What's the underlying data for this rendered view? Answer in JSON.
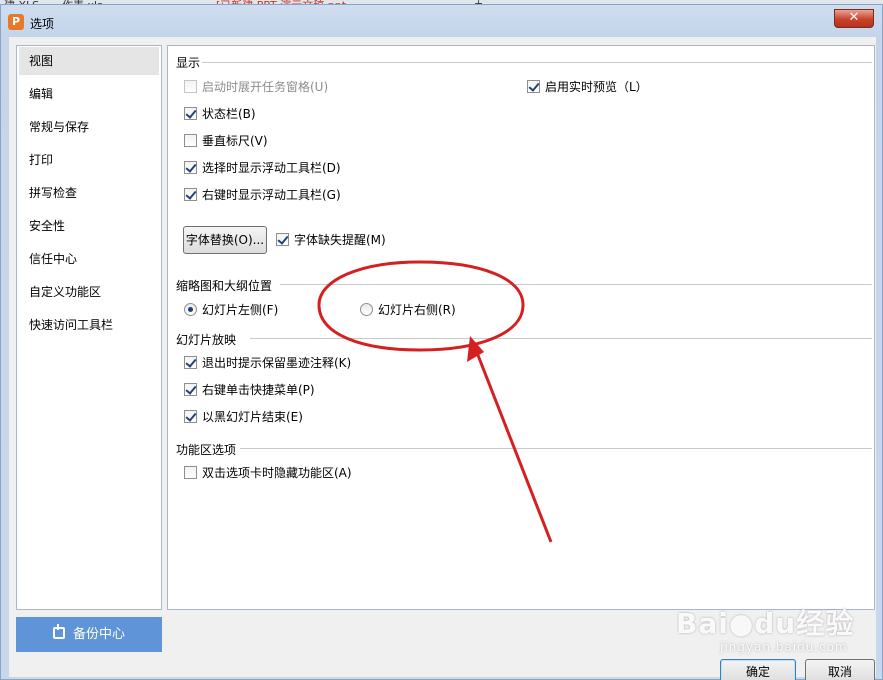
{
  "background_tabs": [
    "建.XLS",
    "作表.xls",
    "[已新建 PPT 演示文稿.ppt",
    "+"
  ],
  "window": {
    "title": "选项",
    "close_label": "✕"
  },
  "nav": {
    "items": [
      {
        "label": "视图",
        "active": true
      },
      {
        "label": "编辑",
        "active": false
      },
      {
        "label": "常规与保存",
        "active": false
      },
      {
        "label": "打印",
        "active": false
      },
      {
        "label": "拼写检查",
        "active": false
      },
      {
        "label": "安全性",
        "active": false
      },
      {
        "label": "信任中心",
        "active": false
      },
      {
        "label": "自定义功能区",
        "active": false
      },
      {
        "label": "快速访问工具栏",
        "active": false
      }
    ],
    "backup_label": "备份中心"
  },
  "display": {
    "heading": "显示",
    "options": {
      "startup_task_pane": {
        "label": "启动时展开任务窗格(U)",
        "checked": false,
        "disabled": true
      },
      "live_preview": {
        "label": "启用实时预览（L）",
        "checked": true
      },
      "status_bar": {
        "label": "状态栏(B)",
        "checked": true
      },
      "vertical_ruler": {
        "label": "垂直标尺(V)",
        "checked": false
      },
      "float_toolbar_select": {
        "label": "选择时显示浮动工具栏(D)",
        "checked": true
      },
      "float_toolbar_rightclick": {
        "label": "右键时显示浮动工具栏(G)",
        "checked": true
      },
      "font_missing_alert": {
        "label": "字体缺失提醒(M)",
        "checked": true
      }
    },
    "font_replace_button": "字体替换(O)..."
  },
  "thumbnail": {
    "heading": "缩略图和大纲位置",
    "left": {
      "label": "幻灯片左侧(F)",
      "checked": true
    },
    "right": {
      "label": "幻灯片右侧(R)",
      "checked": false
    }
  },
  "slideshow": {
    "heading": "幻灯片放映",
    "options": {
      "ink_prompt": {
        "label": "退出时提示保留墨迹注释(K)",
        "checked": true
      },
      "rightclick_menu": {
        "label": "右键单击快捷菜单(P)",
        "checked": true
      },
      "end_black": {
        "label": "以黑幻灯片结束(E)",
        "checked": true
      }
    }
  },
  "ribbon": {
    "heading": "功能区选项",
    "options": {
      "hide_on_dblclick": {
        "label": "双击选项卡时隐藏功能区(A)",
        "checked": false
      }
    }
  },
  "footer": {
    "ok_label": "确定",
    "cancel_label": "取消"
  },
  "watermark": {
    "main": "Bai●du经验",
    "sub": "jingyan.baidu.com"
  },
  "colors": {
    "annotation": "#d42020",
    "backup_button": "#5f95d8",
    "checkmark": "#214478"
  }
}
